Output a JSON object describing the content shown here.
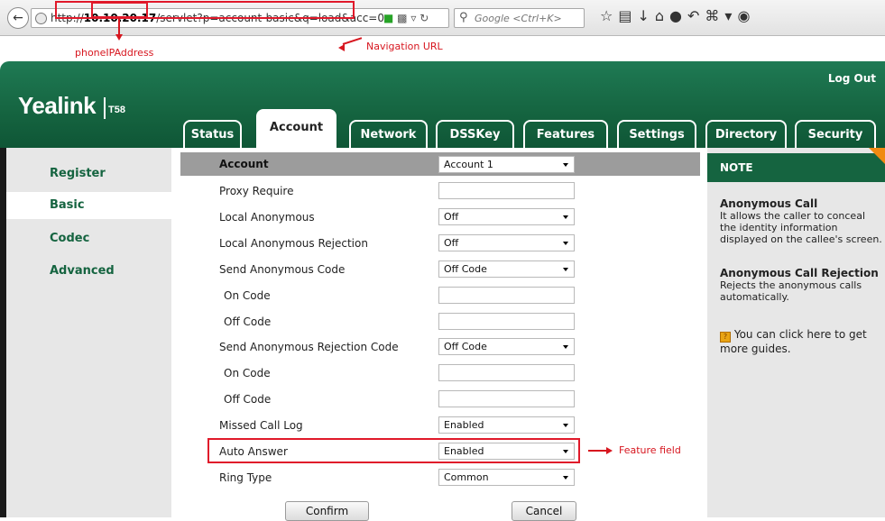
{
  "browser": {
    "url_prefix": "http://",
    "url_host": "10.10.20.17",
    "url_path": "/servlet?p=account-basic&q=load&acc=0",
    "search_placeholder": "Google <Ctrl+K>"
  },
  "annotations": {
    "phone_ip": "phoneIPAddress",
    "navigation_url": "Navigation URL",
    "feature_field": "Feature field"
  },
  "header": {
    "logo": "Yealink",
    "model": "T58",
    "logout": "Log Out",
    "tabs": [
      {
        "label": "Status"
      },
      {
        "label": "Account"
      },
      {
        "label": "Network"
      },
      {
        "label": "DSSKey"
      },
      {
        "label": "Features"
      },
      {
        "label": "Settings"
      },
      {
        "label": "Directory"
      },
      {
        "label": "Security"
      }
    ]
  },
  "sidebar": {
    "items": [
      {
        "label": "Register"
      },
      {
        "label": "Basic"
      },
      {
        "label": "Codec"
      },
      {
        "label": "Advanced"
      }
    ]
  },
  "form": {
    "account_label": "Account",
    "account_value": "Account 1",
    "rows": [
      {
        "label": "Proxy Require",
        "value": ""
      },
      {
        "label": "Local Anonymous",
        "value": "Off"
      },
      {
        "label": "Local Anonymous Rejection",
        "value": "Off"
      },
      {
        "label": "Send Anonymous Code",
        "value": "Off Code"
      },
      {
        "label": "On Code",
        "value": ""
      },
      {
        "label": "Off Code",
        "value": ""
      },
      {
        "label": "Send Anonymous Rejection Code",
        "value": "Off Code"
      },
      {
        "label": "On Code",
        "value": ""
      },
      {
        "label": "Off Code",
        "value": ""
      },
      {
        "label": "Missed Call Log",
        "value": "Enabled"
      },
      {
        "label": "Auto Answer",
        "value": "Enabled"
      },
      {
        "label": "Ring Type",
        "value": "Common"
      }
    ],
    "confirm": "Confirm",
    "cancel": "Cancel"
  },
  "note": {
    "title": "NOTE",
    "anon_title": "Anonymous Call",
    "anon_text": "It allows the caller to conceal the identity information displayed on the callee's screen.",
    "rej_title": "Anonymous Call Rejection",
    "rej_text": "Rejects the anonymous calls automatically.",
    "guide_text": "You can click here to get more guides."
  }
}
